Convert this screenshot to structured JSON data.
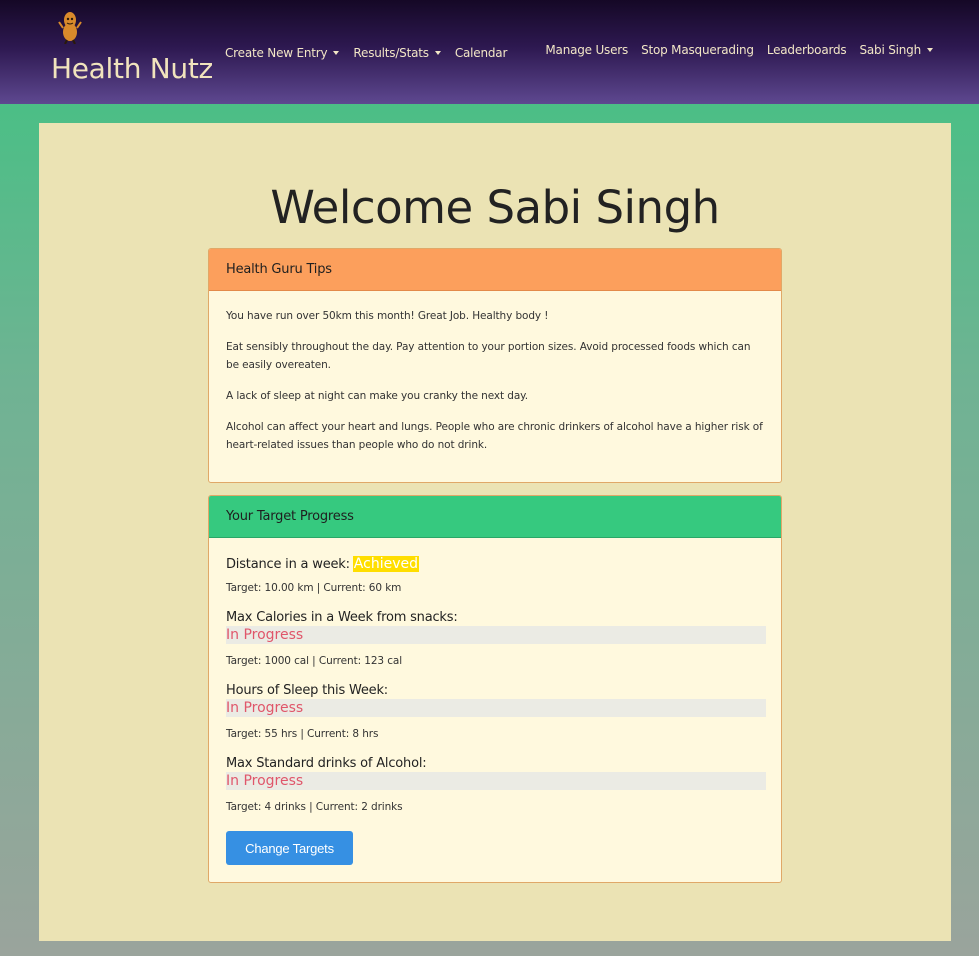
{
  "brand": {
    "name": "Health Nutz",
    "logo": "peanut-mascot-icon"
  },
  "nav": {
    "left": [
      {
        "label": "Create New Entry",
        "dropdown": true
      },
      {
        "label": "Results/Stats",
        "dropdown": true
      },
      {
        "label": "Calendar",
        "dropdown": false
      }
    ],
    "right": [
      {
        "label": "Manage Users",
        "dropdown": false
      },
      {
        "label": "Stop Masquerading",
        "dropdown": false
      },
      {
        "label": "Leaderboards",
        "dropdown": false
      },
      {
        "label": "Sabi Singh",
        "dropdown": true
      }
    ]
  },
  "welcome": "Welcome Sabi Singh",
  "tips": {
    "title": "Health Guru Tips",
    "items": [
      "You have run over 50km this month! Great Job. Healthy body !",
      "Eat sensibly throughout the day. Pay attention to your portion sizes. Avoid processed foods which can be easily overeaten.",
      "A lack of sleep at night can make you cranky the next day.",
      "Alcohol can affect your heart and lungs. People who are chronic drinkers of alcohol have a higher risk of heart-related issues than people who do not drink."
    ]
  },
  "progress": {
    "title": "Your Target Progress",
    "goals": [
      {
        "title": "Distance in a week:",
        "status": "Achieved",
        "meta": "Target: 10.00 km | Current: 60 km"
      },
      {
        "title": "Max Calories in a Week from snacks:",
        "status": "In Progress",
        "meta": "Target: 1000 cal | Current: 123 cal"
      },
      {
        "title": "Hours of Sleep this Week:",
        "status": "In Progress",
        "meta": "Target: 55 hrs | Current: 8 hrs"
      },
      {
        "title": "Max Standard drinks of Alcohol:",
        "status": "In Progress",
        "meta": "Target: 4 drinks | Current: 2 drinks"
      }
    ],
    "button": "Change Targets"
  },
  "colors": {
    "navbar_top": "#150826",
    "navbar_bottom": "#5e4890",
    "tips_header": "#fc9f5c",
    "progress_header": "#36c97f",
    "achieved": "#ffde00",
    "in_progress_text": "#e0566a",
    "button": "#3690e3"
  }
}
